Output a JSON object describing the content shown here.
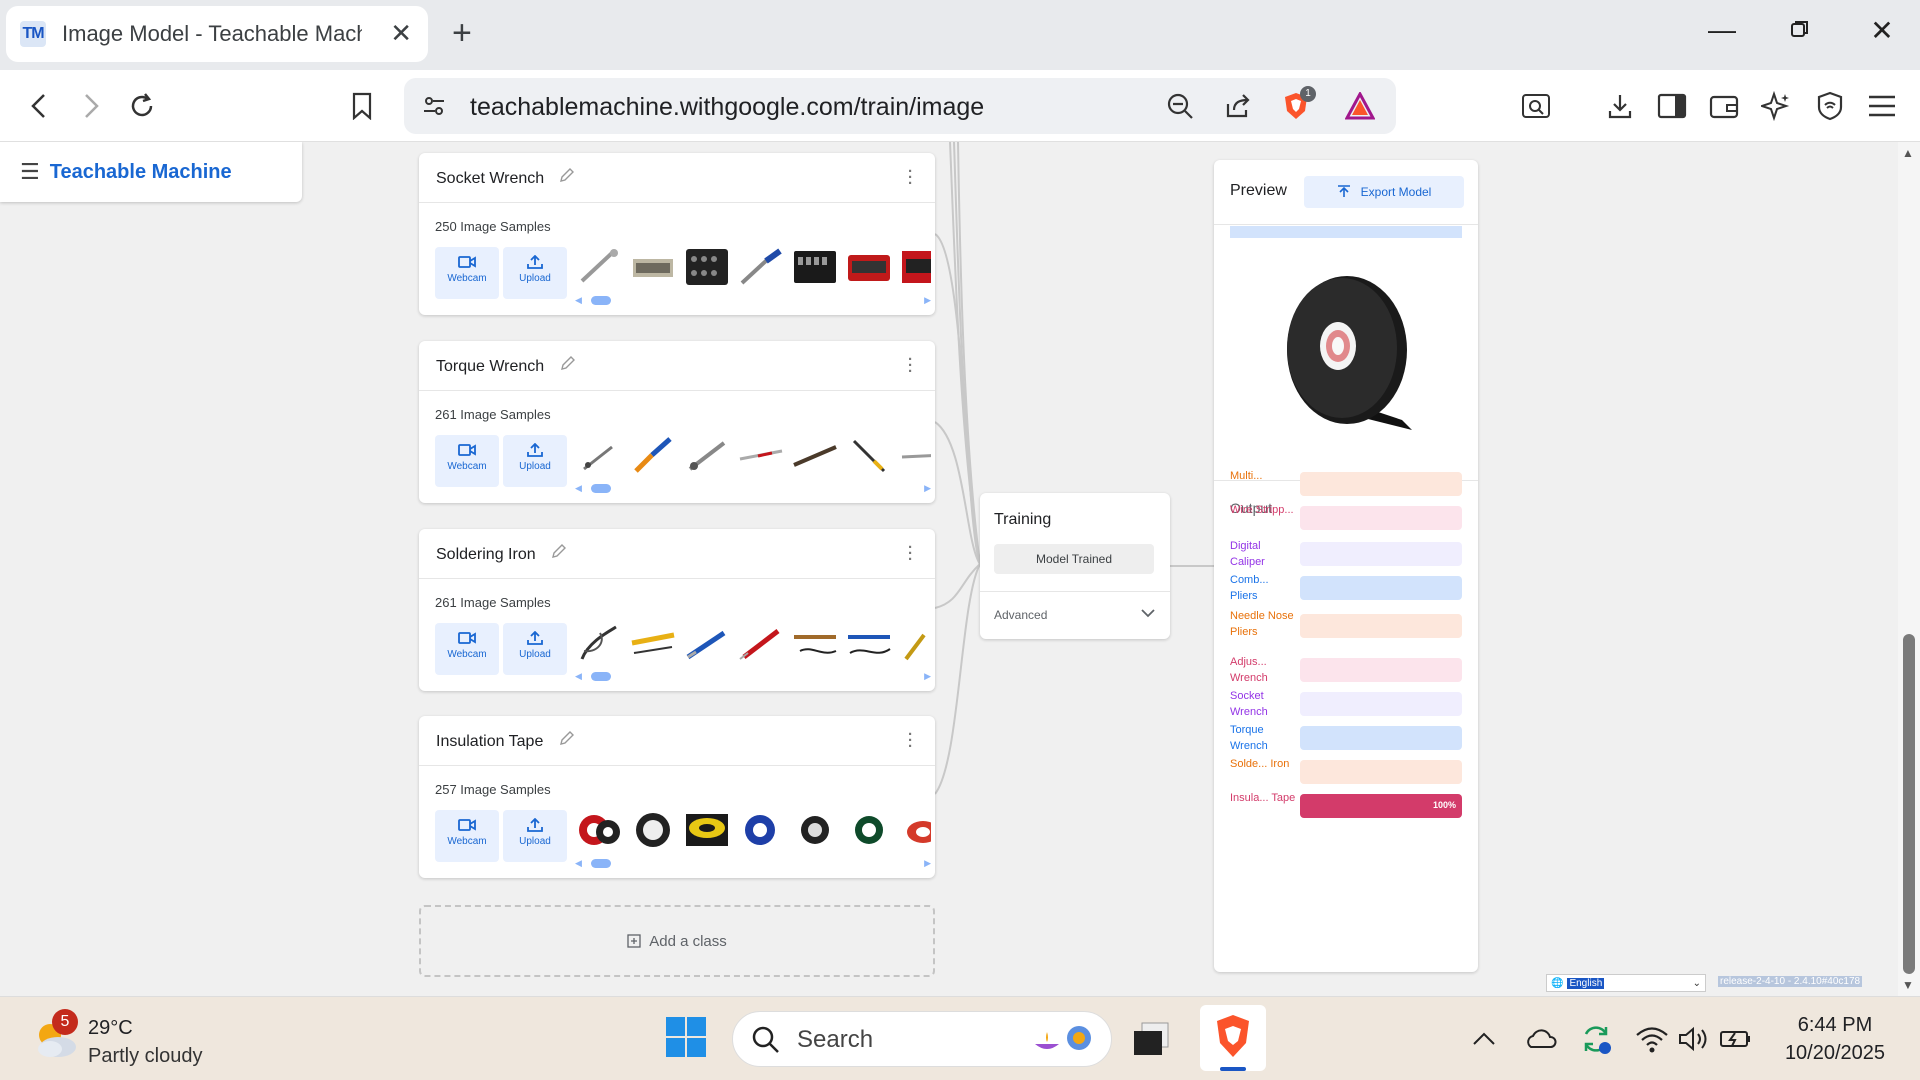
{
  "browser": {
    "tab_favicon": "TM",
    "tab_title": "Image Model - Teachable Machine",
    "url": "teachablemachine.withgoogle.com/train/image",
    "shield_badge": "1"
  },
  "app": {
    "logo": "Teachable Machine",
    "webcam_label": "Webcam",
    "upload_label": "Upload",
    "add_class": "Add a class"
  },
  "classes": [
    {
      "name": "Socket Wrench",
      "samples": "250 Image Samples"
    },
    {
      "name": "Torque Wrench",
      "samples": "261 Image Samples"
    },
    {
      "name": "Soldering Iron",
      "samples": "261 Image Samples"
    },
    {
      "name": "Insulation Tape",
      "samples": "257 Image Samples"
    }
  ],
  "training": {
    "title": "Training",
    "button": "Model Trained",
    "advanced": "Advanced"
  },
  "preview": {
    "title": "Preview",
    "export": "Export Model",
    "output_label": "Output",
    "outputs": [
      {
        "name": "Multi...",
        "color": "#e8710a",
        "bg": "#fde7dc",
        "value": 0,
        "pct": ""
      },
      {
        "name": "Wire Stripp...",
        "color": "#d33b6a",
        "bg": "#fce4ec",
        "value": 0,
        "pct": ""
      },
      {
        "name": "Digital Caliper",
        "color": "#9334e6",
        "bg": "#f0eefe",
        "value": 0,
        "pct": ""
      },
      {
        "name": "Comb... Pliers",
        "color": "#1a73e8",
        "bg": "#d2e3fc",
        "value": 0,
        "pct": ""
      },
      {
        "name": "Needle Nose Pliers",
        "color": "#e8710a",
        "bg": "#fde7dc",
        "value": 0,
        "pct": ""
      },
      {
        "name": "Adjus... Wrench",
        "color": "#d33b6a",
        "bg": "#fce4ec",
        "value": 0,
        "pct": ""
      },
      {
        "name": "Socket Wrench",
        "color": "#9334e6",
        "bg": "#f0eefe",
        "value": 0,
        "pct": ""
      },
      {
        "name": "Torque Wrench",
        "color": "#1a73e8",
        "bg": "#d2e3fc",
        "value": 0,
        "pct": ""
      },
      {
        "name": "Solde... Iron",
        "color": "#e8710a",
        "bg": "#fde7dc",
        "value": 0,
        "pct": ""
      },
      {
        "name": "Insula... Tape",
        "color": "#d33b6a",
        "bg": "#fce4ec",
        "value": 1,
        "pct": "100%"
      }
    ]
  },
  "footer": {
    "language": "English",
    "release": "release-2-4-10 - 2.4.10#40c178"
  },
  "taskbar": {
    "weather_badge": "5",
    "temp": "29°C",
    "condition": "Partly cloudy",
    "search_placeholder": "Search",
    "time": "6:44 PM",
    "date": "10/20/2025"
  }
}
